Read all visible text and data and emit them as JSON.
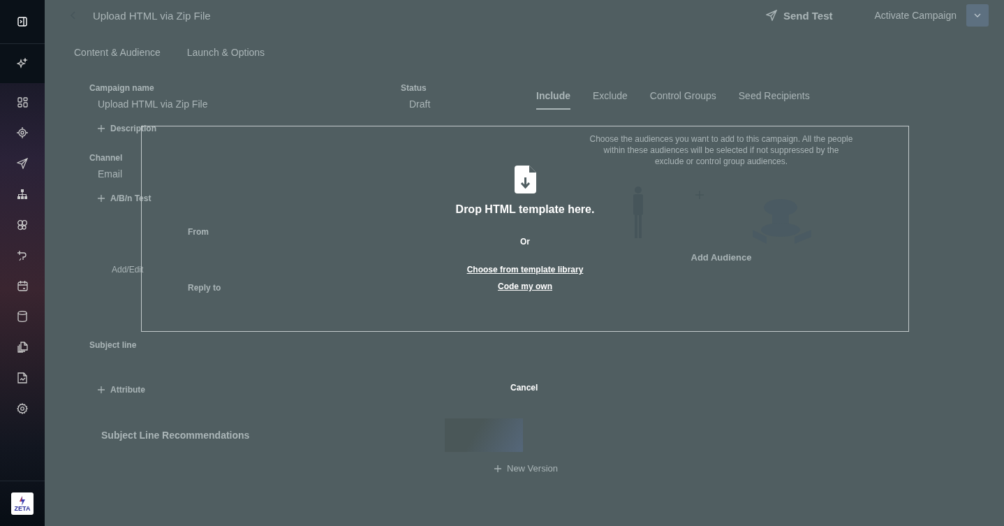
{
  "sidebar": {
    "logo": "ZETA"
  },
  "header": {
    "title": "Upload HTML via Zip File",
    "send_test": "Send Test",
    "activate": "Activate Campaign"
  },
  "tabs": [
    {
      "label": "Content & Audience"
    },
    {
      "label": "Launch & Options"
    }
  ],
  "form": {
    "campaign_name_label": "Campaign name",
    "campaign_name": "Upload HTML via Zip File",
    "status_label": "Status",
    "status": "Draft",
    "description": "Description",
    "channel_label": "Channel",
    "channel": "Email",
    "ab_test": "A/B/n Test",
    "from_label": "From",
    "add_edit": "Add/Edit",
    "reply_to_label": "Reply to",
    "subject_label": "Subject line",
    "attribute": "Attribute",
    "recommendations_title": "Subject Line Recommendations",
    "new_version": "New Version"
  },
  "audience": {
    "tabs": [
      {
        "label": "Include",
        "selected": true
      },
      {
        "label": "Exclude",
        "selected": false
      },
      {
        "label": "Control Groups",
        "selected": false
      },
      {
        "label": "Seed Recipients",
        "selected": false
      }
    ],
    "description": "Choose the audiences you want to add to this campaign. All the people within these audiences will be selected if not suppressed by the exclude or control group audiences.",
    "add_audience": "Add Audience"
  },
  "modal": {
    "heading": "Drop HTML template here.",
    "or": "Or",
    "links": [
      "Choose from template library",
      "Code my own"
    ],
    "cancel": "Cancel"
  }
}
